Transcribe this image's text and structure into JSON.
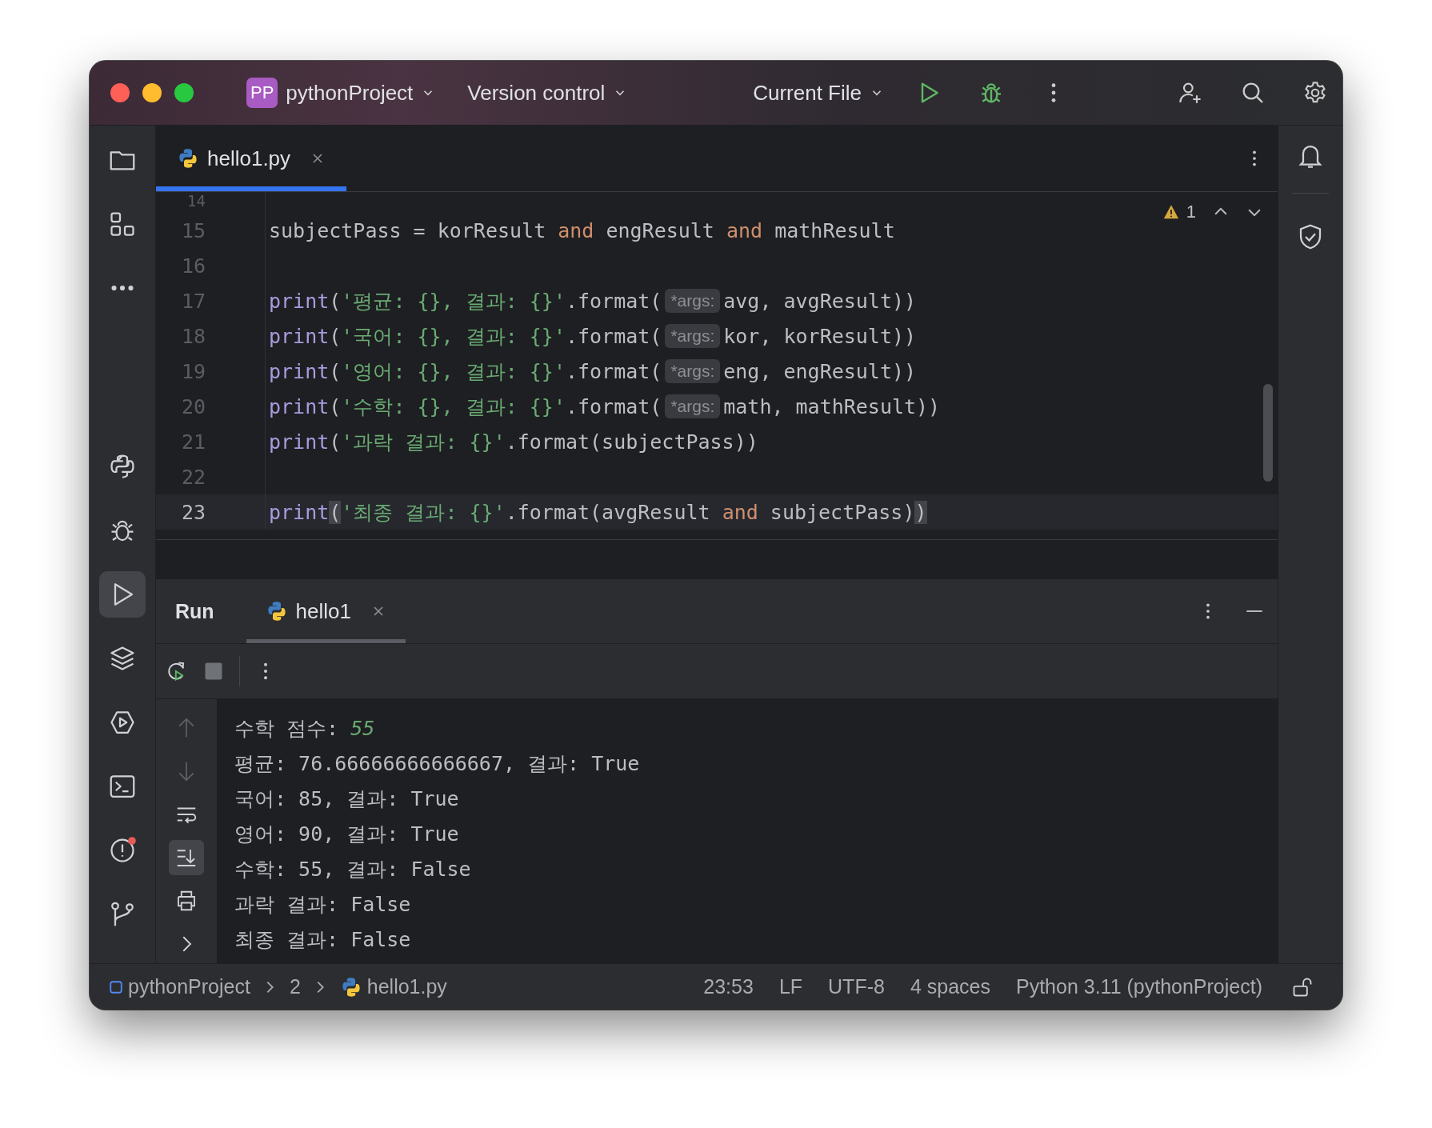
{
  "title_bar": {
    "project_badge": "PP",
    "project": "pythonProject",
    "vcs": "Version control",
    "run_config": "Current File"
  },
  "left_toolbar": [
    {
      "kind": "project",
      "selected": false,
      "notification": false
    },
    {
      "kind": "structure",
      "selected": false,
      "notification": false
    },
    {
      "kind": "more",
      "selected": false,
      "notification": false
    },
    {
      "kind": "python",
      "selected": false,
      "notification": false
    },
    {
      "kind": "debug",
      "selected": false,
      "notification": false
    },
    {
      "kind": "run",
      "selected": true,
      "notification": false
    },
    {
      "kind": "layers",
      "selected": false,
      "notification": false
    },
    {
      "kind": "services",
      "selected": false,
      "notification": false
    },
    {
      "kind": "terminal",
      "selected": false,
      "notification": false
    },
    {
      "kind": "problems",
      "selected": false,
      "notification": true
    },
    {
      "kind": "git",
      "selected": false,
      "notification": false
    }
  ],
  "editor_tabs": [
    {
      "label": "hello1.py",
      "selected": true
    }
  ],
  "editor": {
    "warnings": "1",
    "lines": [
      {
        "number": "14",
        "current": false
      },
      {
        "number": "15",
        "current": false,
        "tokens": [
          {
            "kind": "plain",
            "text": "subjectPass = korResult "
          },
          {
            "kind": "keyword",
            "text": "and"
          },
          {
            "kind": "plain",
            "text": " engResult "
          },
          {
            "kind": "keyword",
            "text": "and"
          },
          {
            "kind": "plain",
            "text": " mathResult"
          }
        ]
      },
      {
        "number": "16",
        "current": false
      },
      {
        "number": "17",
        "current": false,
        "tokens": [
          {
            "kind": "builtin",
            "text": "print"
          },
          {
            "kind": "plain",
            "text": "("
          },
          {
            "kind": "string",
            "text": "'평균: {}, 결과: {}'"
          },
          {
            "kind": "plain",
            "text": ".format("
          },
          {
            "kind": "hint",
            "text": "*args:"
          },
          {
            "kind": "plain",
            "text": "avg, avgResult))"
          }
        ]
      },
      {
        "number": "18",
        "current": false,
        "tokens": [
          {
            "kind": "builtin",
            "text": "print"
          },
          {
            "kind": "plain",
            "text": "("
          },
          {
            "kind": "string",
            "text": "'국어: {}, 결과: {}'"
          },
          {
            "kind": "plain",
            "text": ".format("
          },
          {
            "kind": "hint",
            "text": "*args:"
          },
          {
            "kind": "plain",
            "text": "kor, korResult))"
          }
        ]
      },
      {
        "number": "19",
        "current": false,
        "tokens": [
          {
            "kind": "builtin",
            "text": "print"
          },
          {
            "kind": "plain",
            "text": "("
          },
          {
            "kind": "string",
            "text": "'영어: {}, 결과: {}'"
          },
          {
            "kind": "plain",
            "text": ".format("
          },
          {
            "kind": "hint",
            "text": "*args:"
          },
          {
            "kind": "plain",
            "text": "eng, engResult))"
          }
        ]
      },
      {
        "number": "20",
        "current": false,
        "tokens": [
          {
            "kind": "builtin",
            "text": "print"
          },
          {
            "kind": "plain",
            "text": "("
          },
          {
            "kind": "string",
            "text": "'수학: {}, 결과: {}'"
          },
          {
            "kind": "plain",
            "text": ".format("
          },
          {
            "kind": "hint",
            "text": "*args:"
          },
          {
            "kind": "plain",
            "text": "math, mathResult))"
          }
        ]
      },
      {
        "number": "21",
        "current": false,
        "tokens": [
          {
            "kind": "builtin",
            "text": "print"
          },
          {
            "kind": "plain",
            "text": "("
          },
          {
            "kind": "string",
            "text": "'과락 결과: {}'"
          },
          {
            "kind": "plain",
            "text": ".format(subjectPass))"
          }
        ]
      },
      {
        "number": "22",
        "current": false
      },
      {
        "number": "23",
        "current": true,
        "tokens": [
          {
            "kind": "builtin",
            "text": "print"
          },
          {
            "kind": "match",
            "text": "("
          },
          {
            "kind": "string",
            "text": "'최종 결과: {}'"
          },
          {
            "kind": "plain",
            "text": ".format(avgResult "
          },
          {
            "kind": "keyword",
            "text": "and"
          },
          {
            "kind": "plain",
            "text": " subjectPass)"
          },
          {
            "kind": "match",
            "text": ")"
          }
        ]
      }
    ]
  },
  "run_panel": {
    "title": "Run",
    "tabs": [
      {
        "label": "hello1",
        "selected": true
      }
    ],
    "side_tools": [
      {
        "kind": "up",
        "disabled": true,
        "selected": false
      },
      {
        "kind": "down",
        "disabled": true,
        "selected": false
      },
      {
        "kind": "wrap",
        "disabled": false,
        "selected": false
      },
      {
        "kind": "scroll-end",
        "disabled": false,
        "selected": true
      },
      {
        "kind": "print",
        "disabled": false,
        "selected": false
      },
      {
        "kind": "expand",
        "disabled": false,
        "selected": false
      }
    ],
    "output": [
      [
        {
          "kind": "plain",
          "text": "수학 점수: "
        },
        {
          "kind": "input",
          "text": "55"
        }
      ],
      [
        {
          "kind": "plain",
          "text": "평균: 76.66666666666667, 결과: True"
        }
      ],
      [
        {
          "kind": "plain",
          "text": "국어: 85, 결과: True"
        }
      ],
      [
        {
          "kind": "plain",
          "text": "영어: 90, 결과: True"
        }
      ],
      [
        {
          "kind": "plain",
          "text": "수학: 55, 결과: False"
        }
      ],
      [
        {
          "kind": "plain",
          "text": "과락 결과: False"
        }
      ],
      [
        {
          "kind": "plain",
          "text": "최종 결과: False"
        }
      ]
    ]
  },
  "status_bar": {
    "breadcrumbs": [
      {
        "kind": "project",
        "label": "pythonProject"
      },
      {
        "kind": "folder",
        "label": "2"
      },
      {
        "kind": "file",
        "label": "hello1.py"
      }
    ],
    "items": [
      "23:53",
      "LF",
      "UTF-8",
      "4 spaces",
      "Python 3.11 (pythonProject)"
    ]
  }
}
